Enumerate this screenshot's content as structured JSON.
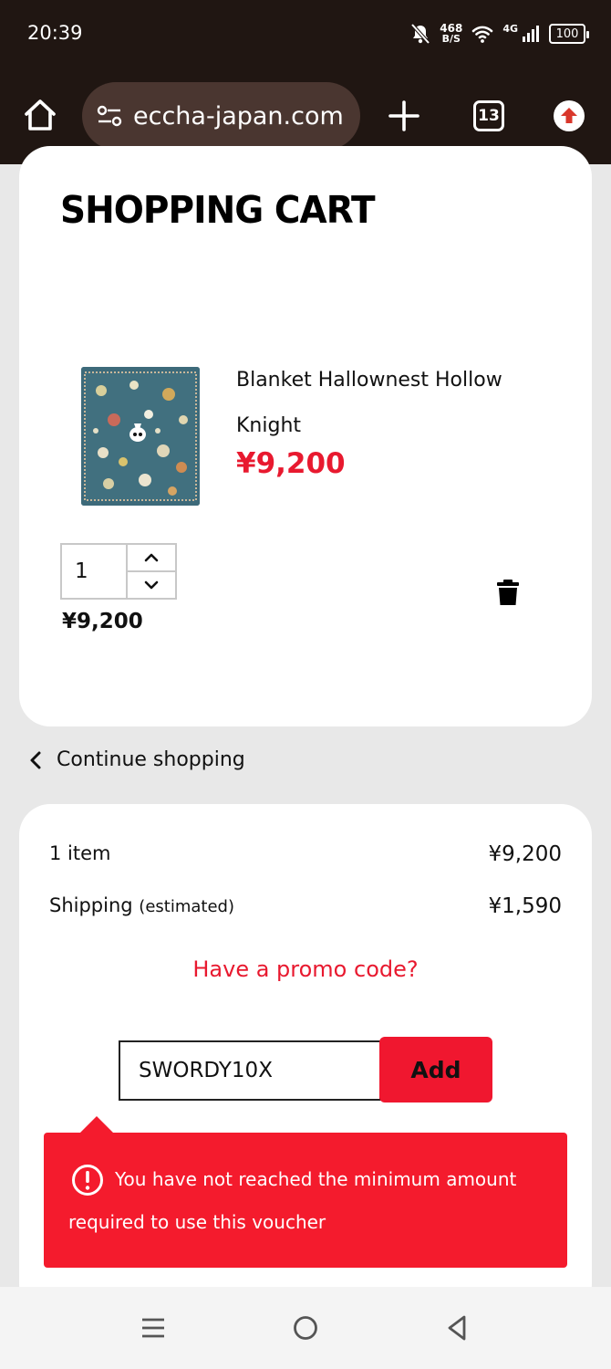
{
  "status_bar": {
    "time": "20:39",
    "speed_value": "468",
    "speed_unit": "B/S",
    "network": "4G",
    "battery": "100",
    "icons": [
      "bell-off-icon",
      "wifi-icon",
      "signal-icon",
      "battery-icon"
    ]
  },
  "browser": {
    "url": "eccha-japan.com",
    "tab_count": "13",
    "icons": [
      "home-icon",
      "site-settings-icon",
      "new-tab-icon",
      "upload-icon"
    ]
  },
  "cart": {
    "title": "SHOPPING CART",
    "item": {
      "name": "Blanket Hallownest Hollow Knight",
      "price": "¥9,200",
      "quantity": "1",
      "line_total": "¥9,200"
    }
  },
  "continue_label": "Continue shopping",
  "summary": {
    "items_label": "1 item",
    "items_value": "¥9,200",
    "shipping_label": "Shipping",
    "shipping_note": "(estimated)",
    "shipping_value": "¥1,590",
    "promo_link": "Have a promo code?",
    "promo_value": "SWORDY10X",
    "add_label": "Add",
    "error_message": "You have not reached the minimum amount required to use this voucher"
  },
  "colors": {
    "accent": "#e8192f",
    "error_bg": "#f41b2d",
    "chrome_bg": "#201612"
  }
}
